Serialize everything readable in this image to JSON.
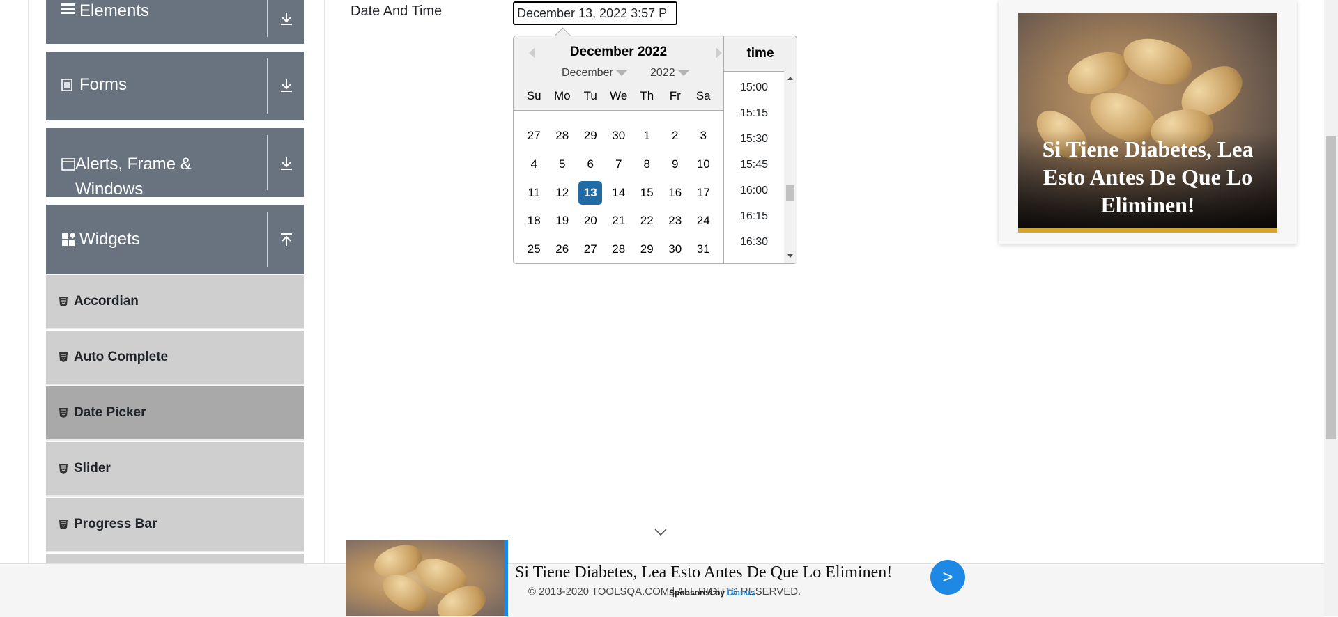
{
  "sidebar": {
    "groups": [
      {
        "label": "Elements",
        "icon": "hamburger-icon",
        "state": "collapsed"
      },
      {
        "label": "Forms",
        "icon": "document-icon",
        "state": "collapsed"
      },
      {
        "label": "Alerts, Frame & Windows",
        "icon": "window-icon",
        "state": "collapsed"
      },
      {
        "label": "Widgets",
        "icon": "widgets-icon",
        "state": "expanded"
      }
    ],
    "items": [
      {
        "label": "Accordian"
      },
      {
        "label": "Auto Complete"
      },
      {
        "label": "Date Picker",
        "active": true
      },
      {
        "label": "Slider"
      },
      {
        "label": "Progress Bar"
      }
    ]
  },
  "form": {
    "date_time_label": "Date And Time",
    "date_time_value": "December 13, 2022 3:57 P"
  },
  "picker": {
    "current_month": "December 2022",
    "month_select": "December",
    "year_select": "2022",
    "weekdays": [
      "Su",
      "Mo",
      "Tu",
      "We",
      "Th",
      "Fr",
      "Sa"
    ],
    "weeks": [
      [
        "27",
        "28",
        "29",
        "30",
        "1",
        "2",
        "3"
      ],
      [
        "4",
        "5",
        "6",
        "7",
        "8",
        "9",
        "10"
      ],
      [
        "11",
        "12",
        "13",
        "14",
        "15",
        "16",
        "17"
      ],
      [
        "18",
        "19",
        "20",
        "21",
        "22",
        "23",
        "24"
      ],
      [
        "25",
        "26",
        "27",
        "28",
        "29",
        "30",
        "31"
      ]
    ],
    "selected_day": "13",
    "time_header": "time",
    "times": [
      "15:00",
      "15:15",
      "15:30",
      "15:45",
      "16:00",
      "16:15",
      "16:30"
    ]
  },
  "ad_right": {
    "headline": "Si Tiene Diabetes, Lea Esto Antes De Que Lo Eliminen!"
  },
  "footer": {
    "copyright": "© 2013-2020 TOOLSQA.COM | ALL RIGHTS RESERVED.",
    "sponsored_prefix": "Sponsored by",
    "sponsored_brand": "Dianus"
  },
  "bottom_ad": {
    "headline": "Si Tiene Diabetes, Lea Esto Antes De Que Lo Eliminen!",
    "cta": ">"
  },
  "colors": {
    "sidebar_header": "#697380",
    "menu_item": "#cfcfcf",
    "menu_item_active": "#a9a9a9",
    "selected_day": "#216ba5",
    "accent_blue": "#1e88e5"
  }
}
